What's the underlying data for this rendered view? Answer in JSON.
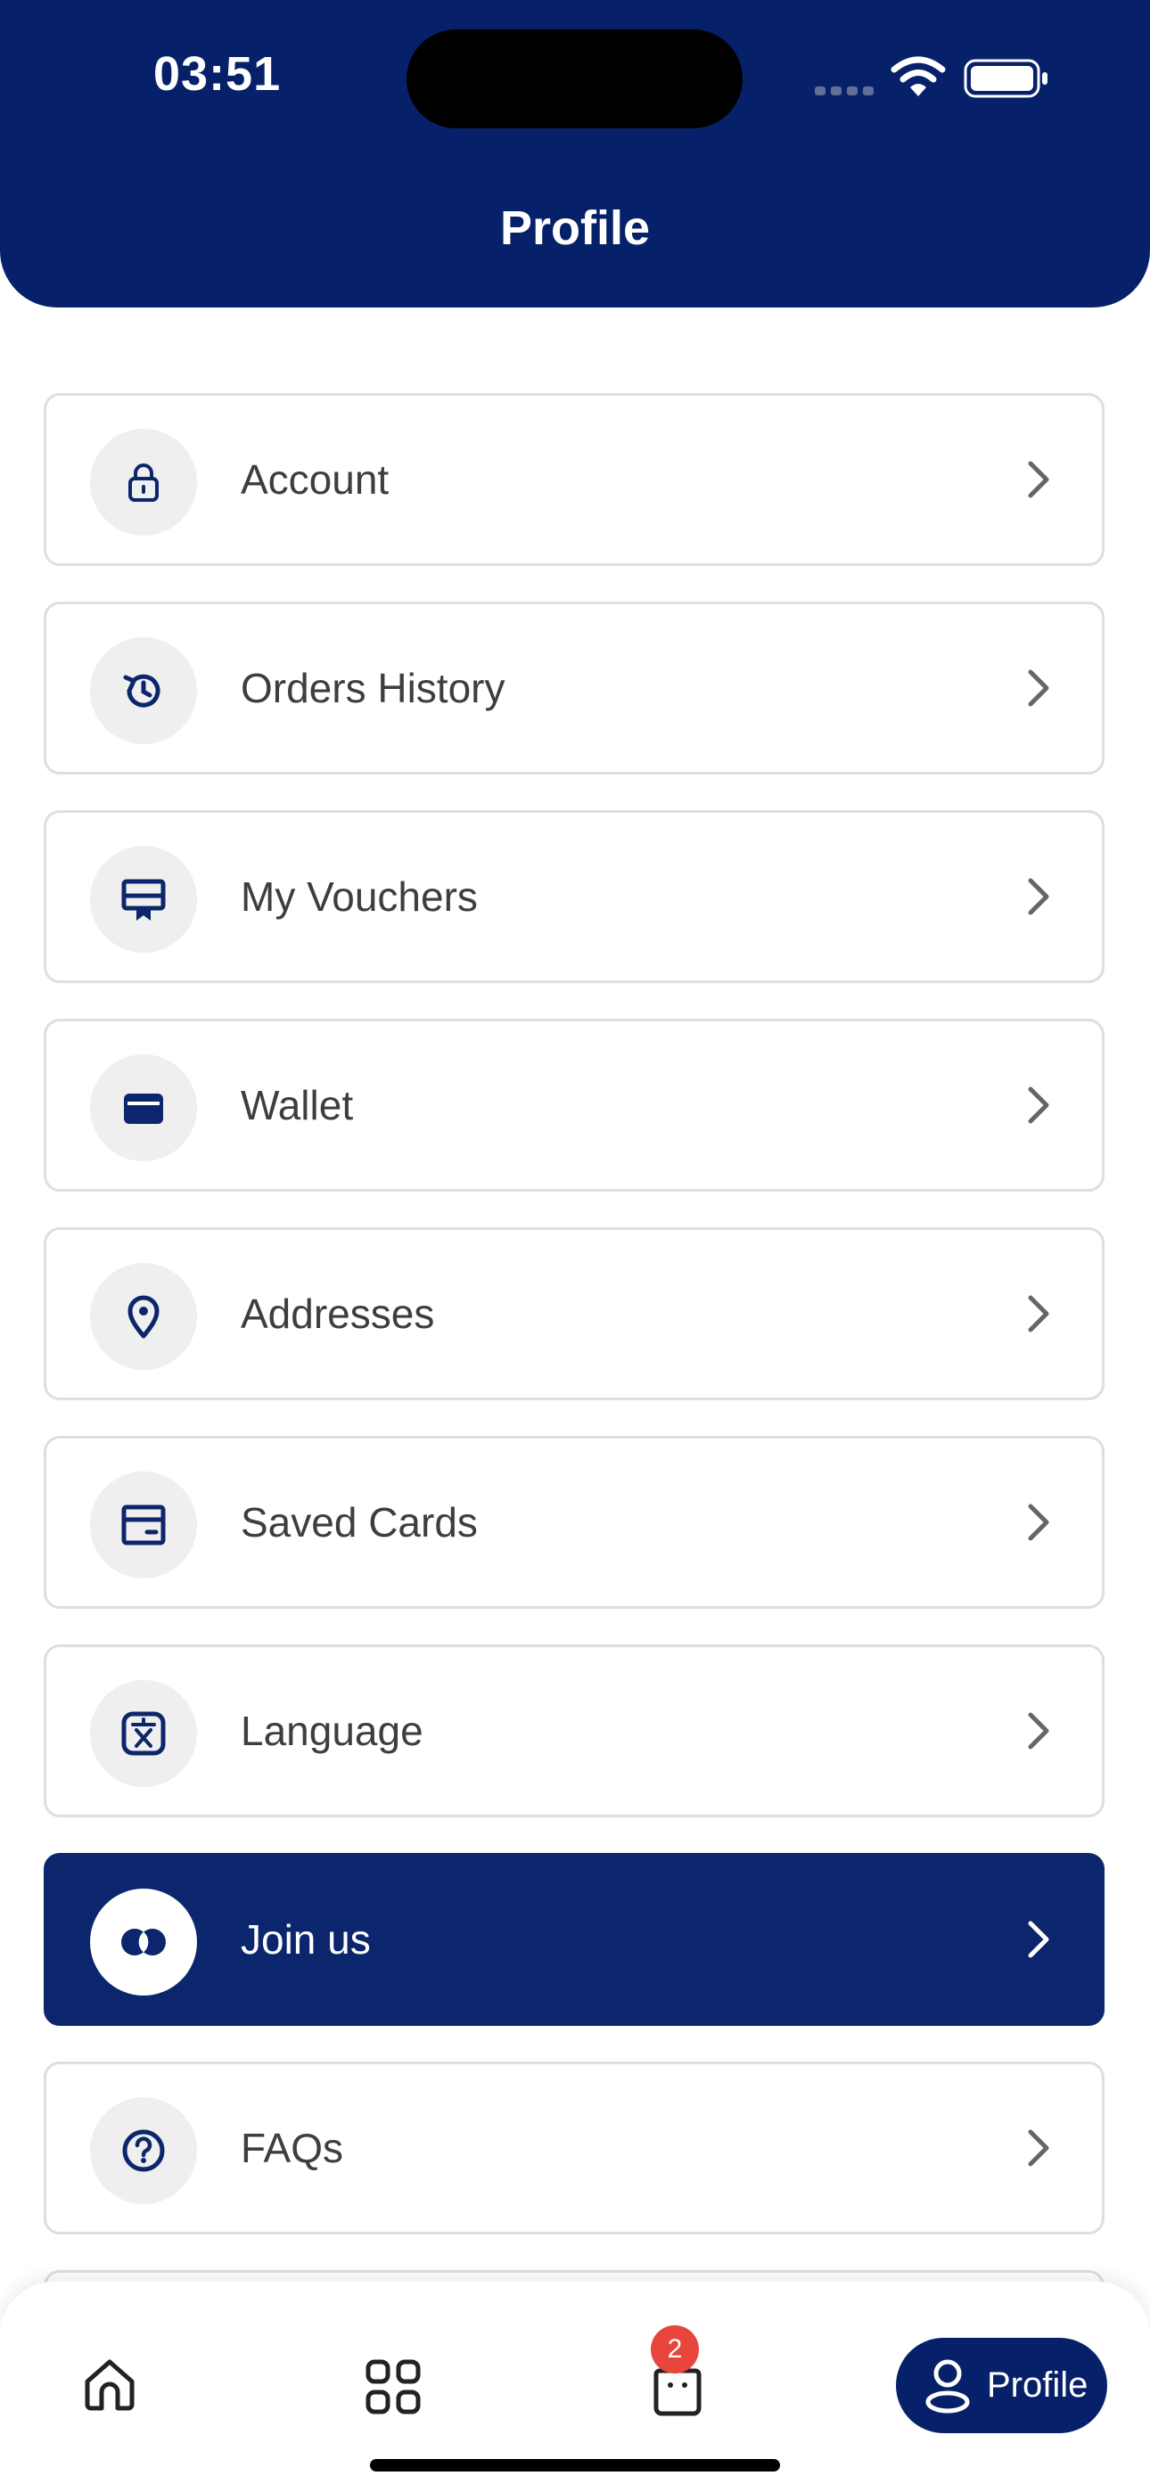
{
  "status_bar": {
    "time": "03:51"
  },
  "header": {
    "title": "Profile",
    "background_color": "#062169"
  },
  "menu": {
    "items": [
      {
        "label": "Account",
        "icon": "lock-icon"
      },
      {
        "label": "Orders History",
        "icon": "history-icon"
      },
      {
        "label": "My Vouchers",
        "icon": "voucher-icon"
      },
      {
        "label": "Wallet",
        "icon": "wallet-icon"
      },
      {
        "label": "Addresses",
        "icon": "location-pin-icon"
      },
      {
        "label": "Saved Cards",
        "icon": "card-icon"
      },
      {
        "label": "Language",
        "icon": "translate-icon"
      },
      {
        "label": "Join us",
        "icon": "join-rings-icon",
        "highlighted": true
      },
      {
        "label": "FAQs",
        "icon": "help-icon"
      }
    ]
  },
  "tab_bar": {
    "cart_badge": "2",
    "profile_label": "Profile",
    "active_tab": "profile",
    "accent_color": "#062169",
    "badge_color": "#e8453c"
  }
}
